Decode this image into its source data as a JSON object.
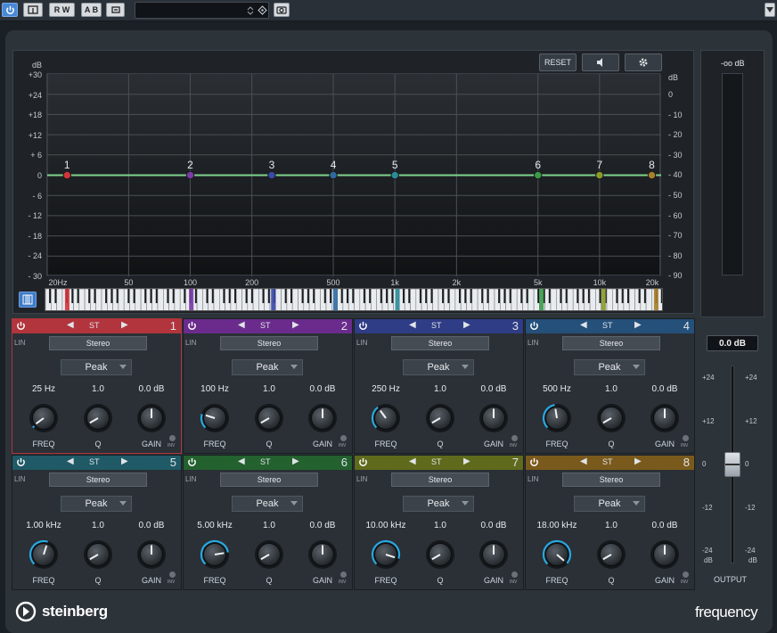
{
  "toolbar": {
    "power_active": true,
    "rw_label": "R W",
    "ab_label": "A B",
    "preset_value": "",
    "preset_placeholder": ""
  },
  "display": {
    "reset_label": "RESET",
    "db_label_left": "dB",
    "db_label_right": "dB",
    "left_scale": [
      "+30",
      "+24",
      "+18",
      "+12",
      "+ 6",
      "0",
      "- 6",
      "- 12",
      "- 18",
      "- 24",
      "- 30"
    ],
    "right_scale": [
      "0",
      "- 10",
      "- 20",
      "- 30",
      "- 40",
      "- 50",
      "- 60",
      "- 70",
      "- 80",
      "- 90"
    ],
    "freq_labels": [
      "20Hz",
      "50",
      "100",
      "200",
      "500",
      "1k",
      "2k",
      "5k",
      "10k",
      "20k"
    ]
  },
  "bands": [
    {
      "num": "1",
      "st": "ST",
      "stereo": "Stereo",
      "lin": "LIN",
      "type": "Peak",
      "freq": "25 Hz",
      "q": "1.0",
      "gain": "0.0 dB",
      "color": "#b2343c",
      "freq_hz": 25,
      "dot": "#d2343c"
    },
    {
      "num": "2",
      "st": "ST",
      "stereo": "Stereo",
      "lin": "LIN",
      "type": "Peak",
      "freq": "100 Hz",
      "q": "1.0",
      "gain": "0.0 dB",
      "color": "#6a2b8c",
      "freq_hz": 100,
      "dot": "#7a3aa8"
    },
    {
      "num": "3",
      "st": "ST",
      "stereo": "Stereo",
      "lin": "LIN",
      "type": "Peak",
      "freq": "250 Hz",
      "q": "1.0",
      "gain": "0.0 dB",
      "color": "#2f3c86",
      "freq_hz": 250,
      "dot": "#3a4aa8"
    },
    {
      "num": "4",
      "st": "ST",
      "stereo": "Stereo",
      "lin": "LIN",
      "type": "Peak",
      "freq": "500 Hz",
      "q": "1.0",
      "gain": "0.0 dB",
      "color": "#24507a",
      "freq_hz": 500,
      "dot": "#2e6aa0"
    },
    {
      "num": "5",
      "st": "ST",
      "stereo": "Stereo",
      "lin": "LIN",
      "type": "Peak",
      "freq": "1.00 kHz",
      "q": "1.0",
      "gain": "0.0 dB",
      "color": "#1f5a66",
      "freq_hz": 1000,
      "dot": "#2b8a98"
    },
    {
      "num": "6",
      "st": "ST",
      "stereo": "Stereo",
      "lin": "LIN",
      "type": "Peak",
      "freq": "5.00 kHz",
      "q": "1.0",
      "gain": "0.0 dB",
      "color": "#23612e",
      "freq_hz": 5000,
      "dot": "#3a9a48"
    },
    {
      "num": "7",
      "st": "ST",
      "stereo": "Stereo",
      "lin": "LIN",
      "type": "Peak",
      "freq": "10.00 kHz",
      "q": "1.0",
      "gain": "0.0 dB",
      "color": "#5f6a1c",
      "freq_hz": 10000,
      "dot": "#8a9a2a"
    },
    {
      "num": "8",
      "st": "ST",
      "stereo": "Stereo",
      "lin": "LIN",
      "type": "Peak",
      "freq": "18.00 kHz",
      "q": "1.0",
      "gain": "0.0 dB",
      "color": "#7a5a1c",
      "freq_hz": 18000,
      "dot": "#a8802a"
    }
  ],
  "knob_labels": {
    "freq": "FREQ",
    "q": "Q",
    "gain": "GAIN",
    "inv": "INV"
  },
  "output": {
    "meter_label": "-oo dB",
    "value": "0.0 dB",
    "label": "OUTPUT",
    "scale": [
      "+24",
      "+12",
      "0",
      "-12",
      "-24"
    ],
    "db_unit": "dB"
  },
  "brand": {
    "name": "steinberg",
    "product": "frequency"
  }
}
